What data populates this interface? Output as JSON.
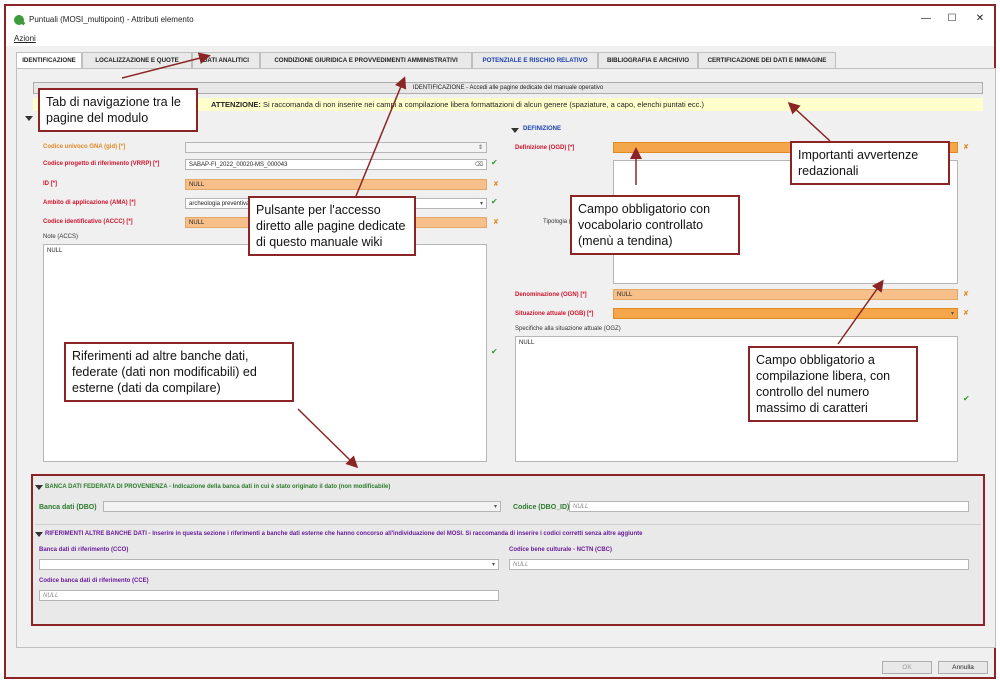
{
  "window": {
    "title": "Puntuali (MOSI_multipoint) - Attributi elemento",
    "menu": "Azioni",
    "minimize": "—",
    "maximize": "☐",
    "close": "✕"
  },
  "tabs": [
    {
      "label": "IDENTIFICAZIONE"
    },
    {
      "label": "LOCALIZZAZIONE E QUOTE"
    },
    {
      "label": "DATI ANALITICI"
    },
    {
      "label": "CONDIZIONE GIURIDICA E PROVVEDIMENTI AMMINISTRATIVI"
    },
    {
      "label": "POTENZIALE E RISCHIO RELATIVO"
    },
    {
      "label": "BIBLIOGRAFIA E ARCHIVIO"
    },
    {
      "label": "CERTIFICAZIONE DEI DATI E IMMAGINE"
    }
  ],
  "wiki_button": "IDENTIFICAZIONE - Accedi alle pagine dedicate del manuale operativo",
  "warning": {
    "prefix": "ATTENZIONE:",
    "text": " Si raccomanda di non inserire nei campi a compilazione libera formattazioni di alcun genere (spaziature, a capo, elenchi puntati ecc.)"
  },
  "left": {
    "gid_label": "Codice univoco GNA (gid) [*]",
    "vrrp_label": "Codice progetto di riferimento (VRRP) [*]",
    "vrrp_value": "SABAP-FI_2022_00020-MS_000043",
    "id_label": "ID [*]",
    "id_value": "NULL",
    "ama_label": "Ambito di applicazione (AMA) [*]",
    "ama_value": "archeologia preventiva",
    "accc_label": "Codice identificativo (ACCC) [*]",
    "accc_value": "NULL",
    "accs_label": "Note (ACCS)",
    "accs_value": "NULL"
  },
  "right": {
    "section_title": "DEFINIZIONE",
    "ogd_label": "Definizione (OGD) [*]",
    "ogt_label": "Tipologia (OGT)",
    "ogn_label": "Denominazione (OGN) [*]",
    "ogn_value": "NULL",
    "ogb_label": "Situazione attuale (OGB) [*]",
    "ogz_label": "Specifiche alla situazione attuale (OGZ)",
    "ogz_value": "NULL"
  },
  "federata": {
    "title": "BANCA DATI FEDERATA DI PROVENIENZA - Indicazione della banca dati in cui è stato originato il dato (non modificabile)",
    "dbo_label": "Banca dati (DBO)",
    "dbo_id_label": "Codice (DBO_ID)",
    "dbo_id_value": "NULL"
  },
  "altre": {
    "title": "RIFERIMENTI ALTRE BANCHE DATI - Inserire in questa sezione i riferimenti a banche dati esterne che hanno concorso all'individuazione del MOSI. Si raccomanda di inserire i codici corretti senza altre aggiunte",
    "cco_label": "Banca dati di riferimento (CCO)",
    "cbc_label": "Codice bene culturale - NCTN (CBC)",
    "cbc_value": "NULL",
    "cce_label": "Codice banca dati di riferimento (CCE)",
    "cce_value": "NULL"
  },
  "buttons": {
    "ok": "OK",
    "cancel": "Annulla"
  },
  "callouts": {
    "tabs": "Tab di navigazione tra le pagine del modulo",
    "wiki": "Pulsante per l'accesso diretto alle pagine dedicate di questo manuale wiki",
    "avvertenze": "Importanti avvertenze redazionali",
    "vocabolario": "Campo obbligatorio con vocabolario controllato (menù a tendina)",
    "libera": "Campo obbligatorio a compilazione libera, con controllo del numero massimo di caratteri",
    "riferimenti": "Riferimenti ad altre banche dati, federate (dati non modificabili) ed esterne (dati da compilare)"
  },
  "colors": {
    "required": "#f7c08a",
    "annotation": "#8b2525",
    "valid": "#2e9b2e"
  }
}
